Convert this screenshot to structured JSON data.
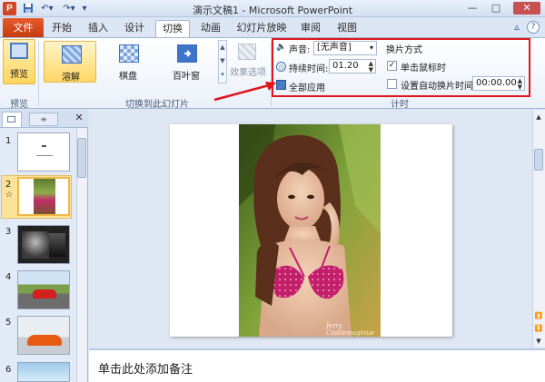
{
  "app": {
    "icon_letter": "P",
    "title": "演示文稿1 - Microsoft PowerPoint"
  },
  "quick_access": [
    "save-icon",
    "undo-icon",
    "redo-icon",
    "customize-icon"
  ],
  "window_controls": {
    "minimize": "—",
    "maximize": "□",
    "close": "✕"
  },
  "tabs": {
    "file": "文件",
    "items": [
      "开始",
      "插入",
      "设计",
      "切换",
      "动画",
      "幻灯片放映",
      "审阅",
      "视图"
    ],
    "active": "切换"
  },
  "ribbon_icons": {
    "minimize": "▵",
    "help": "?"
  },
  "ribbon": {
    "preview": {
      "label": "预览",
      "group": "预览"
    },
    "transitions": {
      "group": "切换到此幻灯片",
      "items": [
        "溶解",
        "棋盘",
        "百叶窗"
      ],
      "selected": "溶解",
      "effect_label": "效果选项"
    },
    "timing": {
      "group": "计时",
      "sound_label": "声音:",
      "sound_value": "[无声音]",
      "duration_label": "持续时间:",
      "duration_value": "01.20",
      "apply_all_label": "全部应用",
      "advance_heading": "换片方式",
      "on_click_label": "单击鼠标时",
      "on_click_checked": true,
      "after_label": "设置自动换片时间:",
      "after_checked": false,
      "after_value": "00:00.00"
    }
  },
  "slides_panel": {
    "tab_outline_icon": "≡",
    "close": "✕",
    "slides": [
      {
        "number": "1"
      },
      {
        "number": "2",
        "star": "☆"
      },
      {
        "number": "3"
      },
      {
        "number": "4"
      },
      {
        "number": "5"
      },
      {
        "number": "6"
      }
    ]
  },
  "notes": {
    "placeholder": "单击此处添加备注"
  },
  "photo_signature": "Jerry Castlemaginue",
  "colors": {
    "accent_red": "#e0141e",
    "file_tab": "#d24726",
    "selected_gallery": "#ffd764"
  }
}
